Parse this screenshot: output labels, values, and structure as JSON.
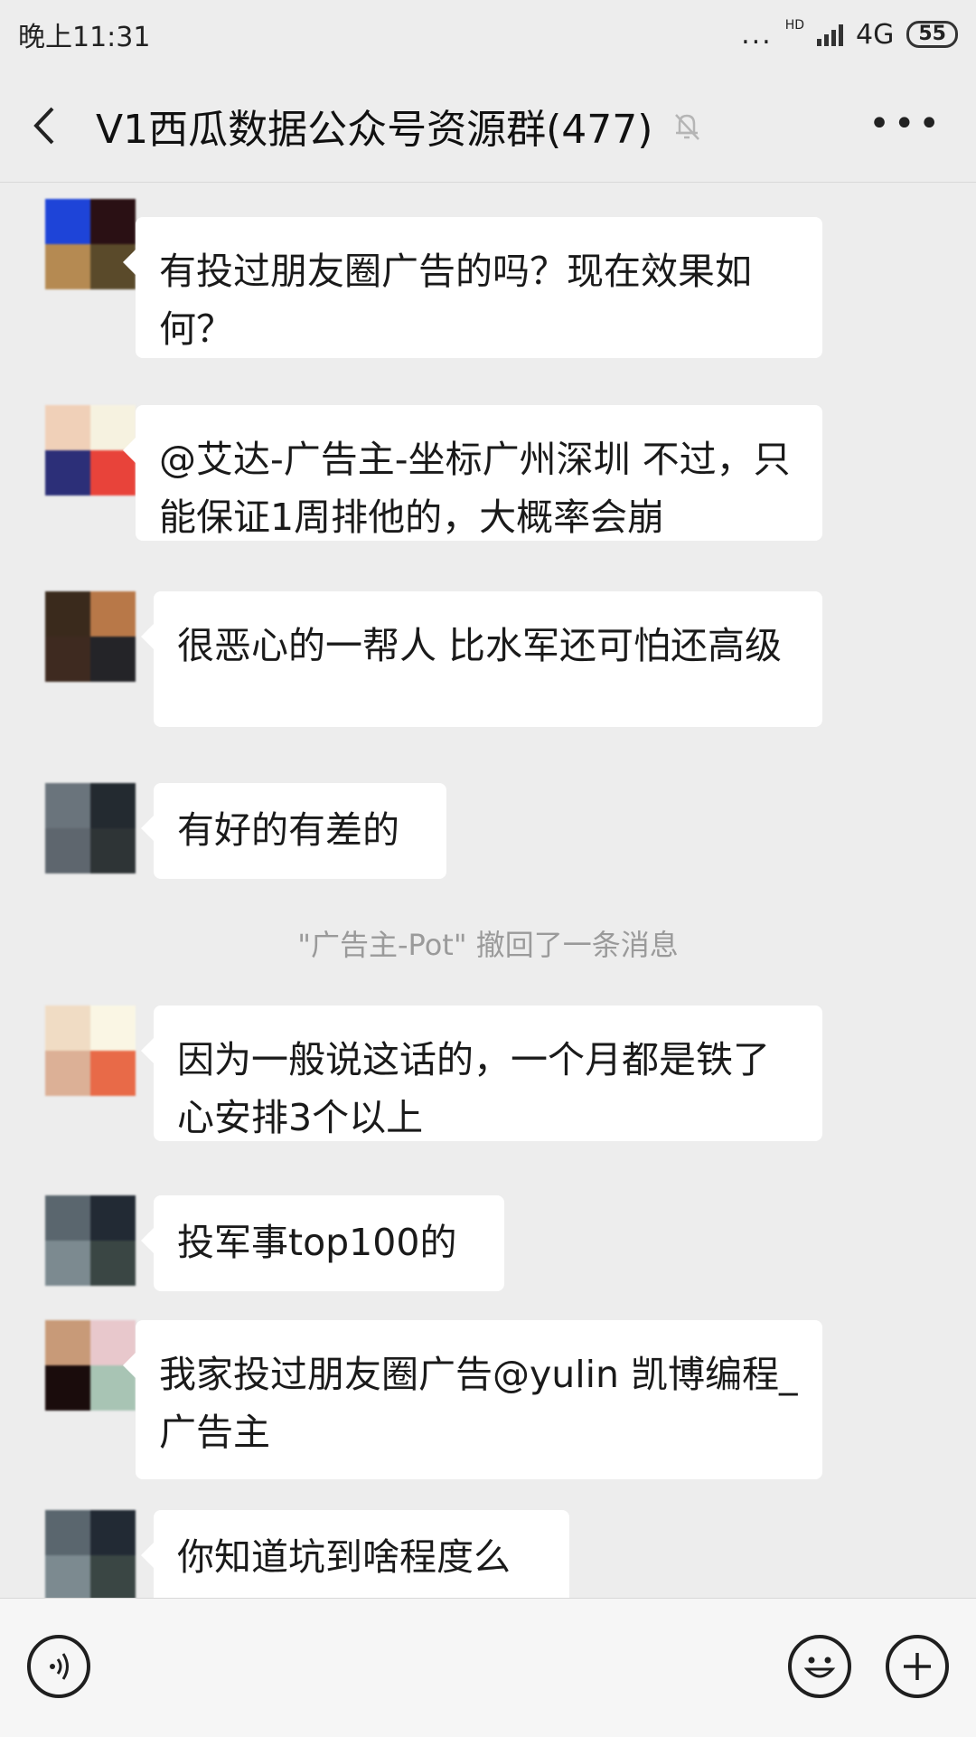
{
  "status_bar": {
    "time": "晚上11:31",
    "dots": "...",
    "hd": "HD",
    "network": "4G",
    "battery": "55"
  },
  "header": {
    "title": "V1西瓜数据公众号资源群(477)",
    "more": "•••"
  },
  "messages": [
    {
      "text": "有投过朋友圈广告的吗？现在效果如何？"
    },
    {
      "text": "@艾达-广告主-坐标广州深圳 不过，只能保证1周排他的，大概率会崩"
    },
    {
      "text": "很恶心的一帮人 比水军还可怕还高级"
    },
    {
      "text": "有好的有差的"
    },
    {
      "text": "因为一般说这话的，一个月都是铁了心安排3个以上"
    },
    {
      "text": "投军事top100的"
    },
    {
      "text": "我家投过朋友圈广告@yulin 凯博编程_广告主"
    },
    {
      "text": "你知道坑到啥程度么"
    }
  ],
  "system_notice": "\"广告主-Pot\" 撤回了一条消息",
  "colors": {
    "background": "#ededed",
    "bubble": "#ffffff",
    "system_text": "#9a9a9a"
  },
  "icons": {
    "back": "chevron-left-icon",
    "mute": "bell-off-icon",
    "voice": "voice-icon",
    "emoji": "emoji-icon",
    "plus": "plus-icon"
  }
}
